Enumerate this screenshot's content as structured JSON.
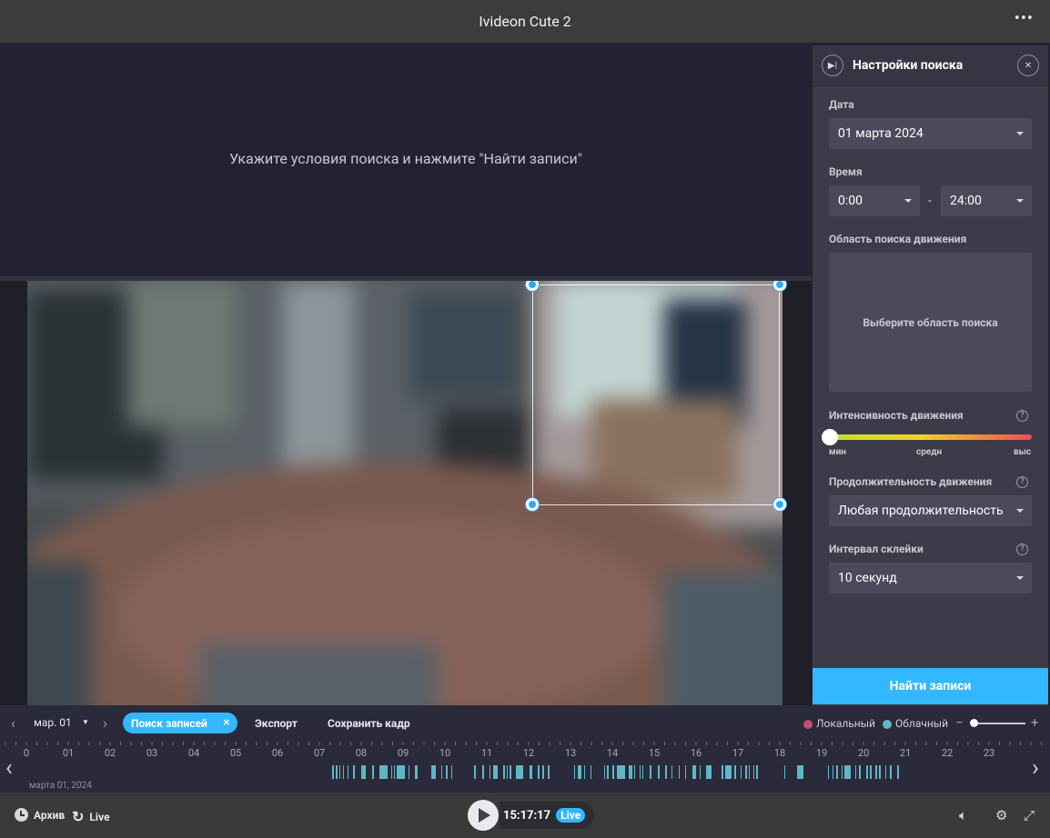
{
  "app": {
    "title": "Ivideon Cute 2",
    "menu_icon": "more-horizontal-icon"
  },
  "results": {
    "message": "Укажите условия поиска и нажмите \"Найти записи\""
  },
  "panel": {
    "title": "Настройки поиска",
    "date_label": "Дата",
    "date_value": "01 марта 2024",
    "time_label": "Время",
    "time_from": "0:00",
    "time_separator": "-",
    "time_to": "24:00",
    "area_label": "Область поиска движения",
    "area_placeholder": "Выберите область поиска",
    "intensity_label": "Интенсивность движения",
    "intensity_value": 0,
    "intensity_marks": [
      "мин",
      "средн",
      "выс"
    ],
    "duration_label": "Продолжительность движения",
    "duration_value": "Любая продолжительность",
    "interval_label": "Интервал склейки",
    "interval_value": "10 секунд",
    "help": "?",
    "find_button": "Найти записи"
  },
  "toolbar": {
    "date": "мар. 01",
    "search_records": "Поиск записей",
    "close": "×",
    "export": "Экспорт",
    "save_frame": "Сохранить кадр",
    "local": "Локальный",
    "cloud": "Облачный",
    "zoom_minus": "−",
    "zoom_plus": "+",
    "colors": {
      "local": "#c0506e",
      "cloud": "#5fb7c6",
      "accent": "#33b8ff"
    }
  },
  "timeline": {
    "hours": [
      "0",
      "01",
      "02",
      "03",
      "04",
      "05",
      "06",
      "07",
      "08",
      "09",
      "10",
      "11",
      "12",
      "13",
      "14",
      "15",
      "16",
      "17",
      "18",
      "19",
      "20",
      "21",
      "22",
      "23"
    ],
    "date": "марта 01, 2024"
  },
  "bottom": {
    "archive": "Архив",
    "live": "Live",
    "time": "15:17:17",
    "live_badge": "Live"
  }
}
